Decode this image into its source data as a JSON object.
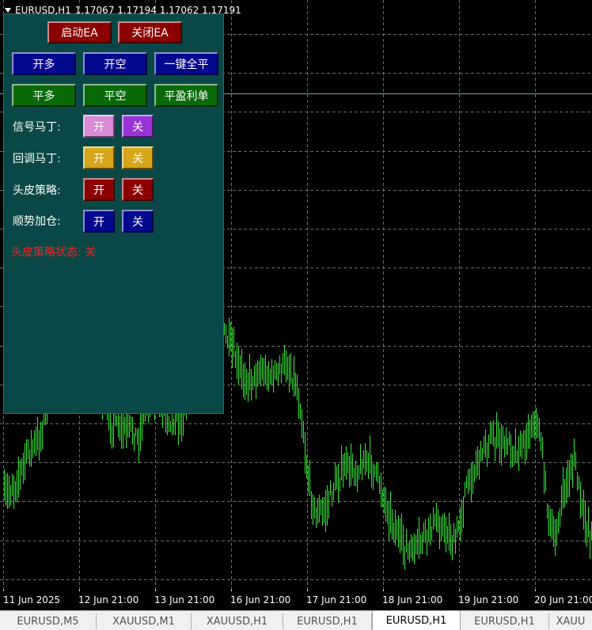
{
  "window": {
    "symbol_title": "EURUSD,H1",
    "ohlc": "1.17067 1.17194 1.17062 1.17191"
  },
  "panel": {
    "start_ea": "启动EA",
    "close_ea": "关闭EA",
    "open_long": "开多",
    "open_short": "开空",
    "close_all": "一键全平",
    "close_long": "平多",
    "close_short": "平空",
    "close_profit": "平盈利单",
    "rows": [
      {
        "label": "信号马丁:",
        "on": "开",
        "off": "关"
      },
      {
        "label": "回调马丁:",
        "on": "开",
        "off": "关"
      },
      {
        "label": "头皮策略:",
        "on": "开",
        "off": "关"
      },
      {
        "label": "顺势加仓:",
        "on": "开",
        "off": "关"
      }
    ],
    "status_text": "头皮策略状态: 关"
  },
  "colors": {
    "candle": "#39e639",
    "grid": "#6b6b6b",
    "panel_bg": "#0a4848"
  },
  "chart_data": {
    "type": "candlestick",
    "symbol": "EURUSD",
    "timeframe": "H1",
    "last_bar": {
      "open": 1.17067,
      "high": 1.17194,
      "low": 1.17062,
      "close": 1.17191
    },
    "x_tick_labels": [
      "11 Jun 2025",
      "12 Jun 21:00",
      "13 Jun 21:00",
      "16 Jun 21:00",
      "17 Jun 21:00",
      "18 Jun 21:00",
      "19 Jun 21:00",
      "20 Jun 21:00"
    ],
    "grid": true
  },
  "tabs": [
    "EURUSD,M5",
    "XAUUSD,M1",
    "XAUUSD,H1",
    "EURUSD,H1",
    "EURUSD,H1",
    "EURUSD,H1",
    "XAUU"
  ],
  "active_tab": 4
}
